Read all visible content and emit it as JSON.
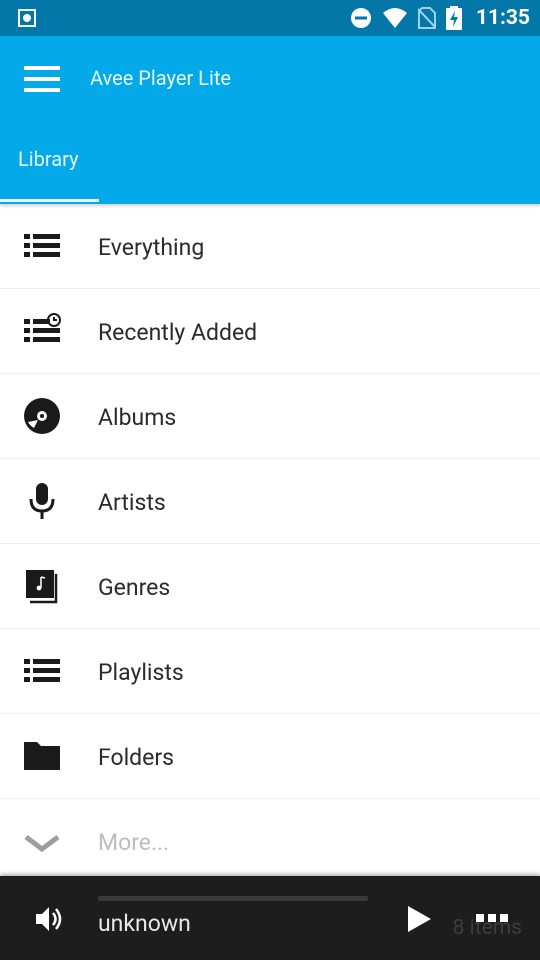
{
  "status_bar": {
    "time": "11:35",
    "icons": [
      "screen-record-icon",
      "do-not-disturb-icon",
      "wifi-icon",
      "no-sim-icon",
      "battery-charging-icon"
    ]
  },
  "app": {
    "title": "Avee Player Lite",
    "menu_icon": "hamburger-menu-icon"
  },
  "tabs": [
    {
      "label": "Library",
      "active": true
    }
  ],
  "library": {
    "items": [
      {
        "label": "Everything",
        "icon": "list-icon"
      },
      {
        "label": "Recently Added",
        "icon": "recent-list-icon"
      },
      {
        "label": "Albums",
        "icon": "disc-icon"
      },
      {
        "label": "Artists",
        "icon": "microphone-icon"
      },
      {
        "label": "Genres",
        "icon": "music-note-box-icon"
      },
      {
        "label": "Playlists",
        "icon": "playlist-icon"
      },
      {
        "label": "Folders",
        "icon": "folder-icon"
      },
      {
        "label": "More...",
        "icon": "chevron-down-icon"
      }
    ]
  },
  "player": {
    "track": "unknown",
    "items_count": "8 items",
    "progress": 0.0,
    "colors": {
      "bar_bg": "#1d1d1d",
      "accent": "#03a9e9"
    }
  },
  "colors": {
    "status_bar": "#0277a8",
    "app_bar": "#03a9e9"
  }
}
